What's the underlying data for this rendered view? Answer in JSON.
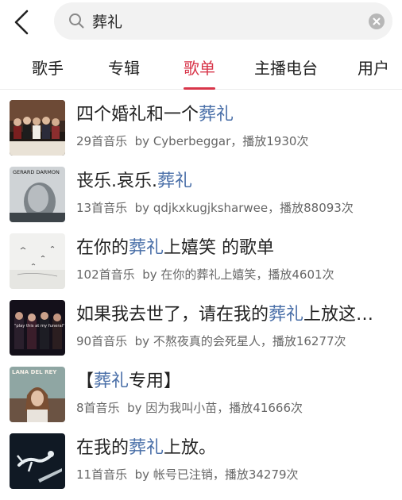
{
  "search": {
    "query": "葬礼"
  },
  "tabs": [
    {
      "label": "歌手"
    },
    {
      "label": "专辑"
    },
    {
      "label": "歌单"
    },
    {
      "label": "主播电台"
    },
    {
      "label": "用户"
    }
  ],
  "playlists": [
    {
      "title_pre": "四个婚礼和一个",
      "title_hl": "葬礼",
      "title_post": "",
      "count": "29首音乐",
      "by": "by",
      "author": "Cyberbeggar",
      "plays": "，播放1930次",
      "cover": "wedding-party-cover"
    },
    {
      "title_pre": "丧乐.哀乐.",
      "title_hl": "葬礼",
      "title_post": "",
      "count": "13首音乐",
      "by": "by",
      "author": "qdjkxkugjksharwee",
      "plays": "，播放88093次",
      "cover": "gerard-darmon-cover",
      "cover_text": "GERARD DARMON"
    },
    {
      "title_pre": "在你的",
      "title_hl": "葬礼",
      "title_post": "上嬉笑 的歌单",
      "count": "102首音乐",
      "by": "by",
      "author": "在你的葬礼上嬉笑",
      "plays": "，播放4601次",
      "cover": "birds-sky-cover"
    },
    {
      "title_pre": "如果我去世了，请在我的",
      "title_hl": "葬礼",
      "title_post": "上放这…",
      "count": "90首音乐",
      "by": "by",
      "author": "不熬夜真的会死星人",
      "plays": "，播放16277次",
      "cover": "band-photo-cover",
      "cover_text": "\"play this at my funeral\""
    },
    {
      "title_pre": "【",
      "title_hl": "葬礼",
      "title_post": "专用】",
      "count": "8首音乐",
      "by": "by",
      "author": "因为我叫小苗",
      "plays": "，播放41666次",
      "cover": "lana-del-rey-cover",
      "cover_text": "LANA DEL REY"
    },
    {
      "title_pre": "在我的",
      "title_hl": "葬礼",
      "title_post": "上放。",
      "count": "11首音乐",
      "by": "by",
      "author": "帐号已注销",
      "plays": "，播放34279次",
      "cover": "falling-figure-cover"
    }
  ],
  "colors": {
    "accent": "#d8364a",
    "highlight": "#4a6fa8"
  }
}
